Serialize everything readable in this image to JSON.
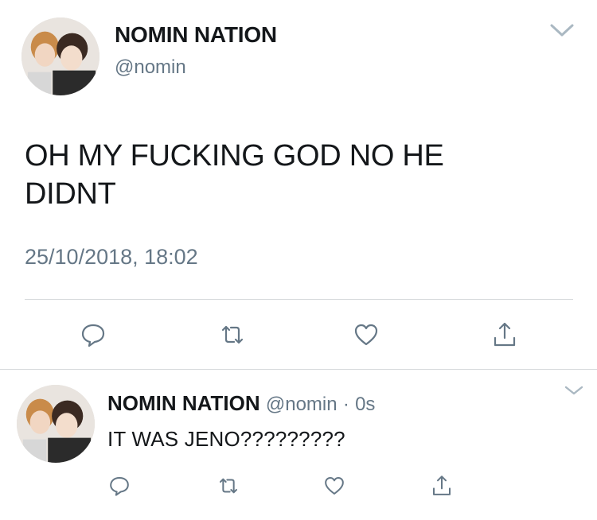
{
  "tweet": {
    "author_name": "NOMIN NATION",
    "author_handle": "@nomin",
    "text": "OH MY FUCKING GOD NO HE DIDNT",
    "timestamp": "25/10/2018, 18:02",
    "menu_icon": "chevron-down-icon",
    "actions": [
      "reply-icon",
      "retweet-icon",
      "like-icon",
      "share-icon"
    ]
  },
  "reply": {
    "author_name": "NOMIN NATION",
    "author_handle": "@nomin",
    "separator": "·",
    "time": "0s",
    "text": "IT WAS JENO?????????",
    "menu_icon": "chevron-down-icon",
    "actions": [
      "reply-icon",
      "retweet-icon",
      "like-icon",
      "share-icon"
    ]
  },
  "colors": {
    "text_primary": "#14171a",
    "text_secondary": "#657786",
    "divider": "#d6d9db",
    "icon": "#657786"
  }
}
